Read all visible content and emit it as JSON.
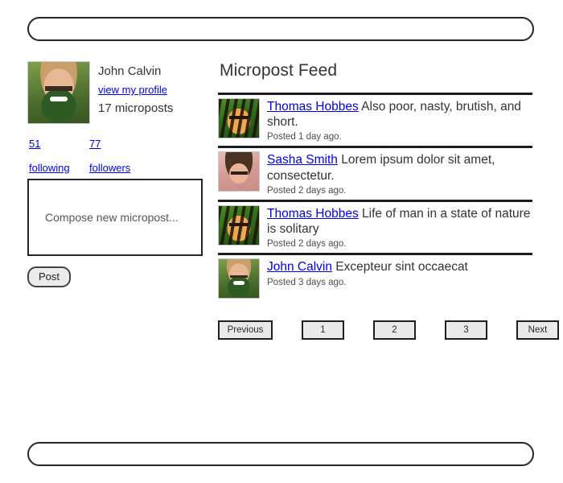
{
  "header": {
    "bar_label": ""
  },
  "footer": {
    "bar_label": ""
  },
  "sidebar": {
    "user": {
      "name": "John Calvin",
      "profile_link": "view my profile",
      "micropost_count": "17 microposts",
      "avatar": "boy-avatar"
    },
    "stats": [
      {
        "value": "51",
        "label": "following",
        "name": "following"
      },
      {
        "value": "77",
        "label": "followers",
        "name": "followers"
      }
    ],
    "compose": {
      "placeholder": "Compose new micropost...",
      "submit_label": "Post"
    }
  },
  "feed": {
    "title": "Micropost Feed",
    "posts": [
      {
        "author": "Thomas Hobbes",
        "text": " Also poor, nasty, brutish, and short.",
        "time": "Posted 1 day ago.",
        "avatar": "tiger-avatar"
      },
      {
        "author": "Sasha Smith",
        "text": " Lorem ipsum dolor sit amet, consectetur.",
        "time": "Posted 2 days ago.",
        "avatar": "woman-avatar"
      },
      {
        "author": "Thomas Hobbes",
        "text": " Life of man in a state of nature is solitary",
        "time": "Posted 2 days ago.",
        "avatar": "tiger-avatar"
      },
      {
        "author": "John Calvin",
        "text": " Excepteur sint occaecat",
        "time": "Posted 3 days ago.",
        "avatar": "boy-avatar"
      }
    ]
  },
  "pagination": {
    "previous_label": "Previous",
    "pages": [
      "1",
      "2",
      "3"
    ],
    "next_label": "Next"
  },
  "colors": {
    "link": "#0000ee",
    "text": "#333333",
    "border": "#1c1c1c",
    "button_fill": "#e9e9e9"
  }
}
